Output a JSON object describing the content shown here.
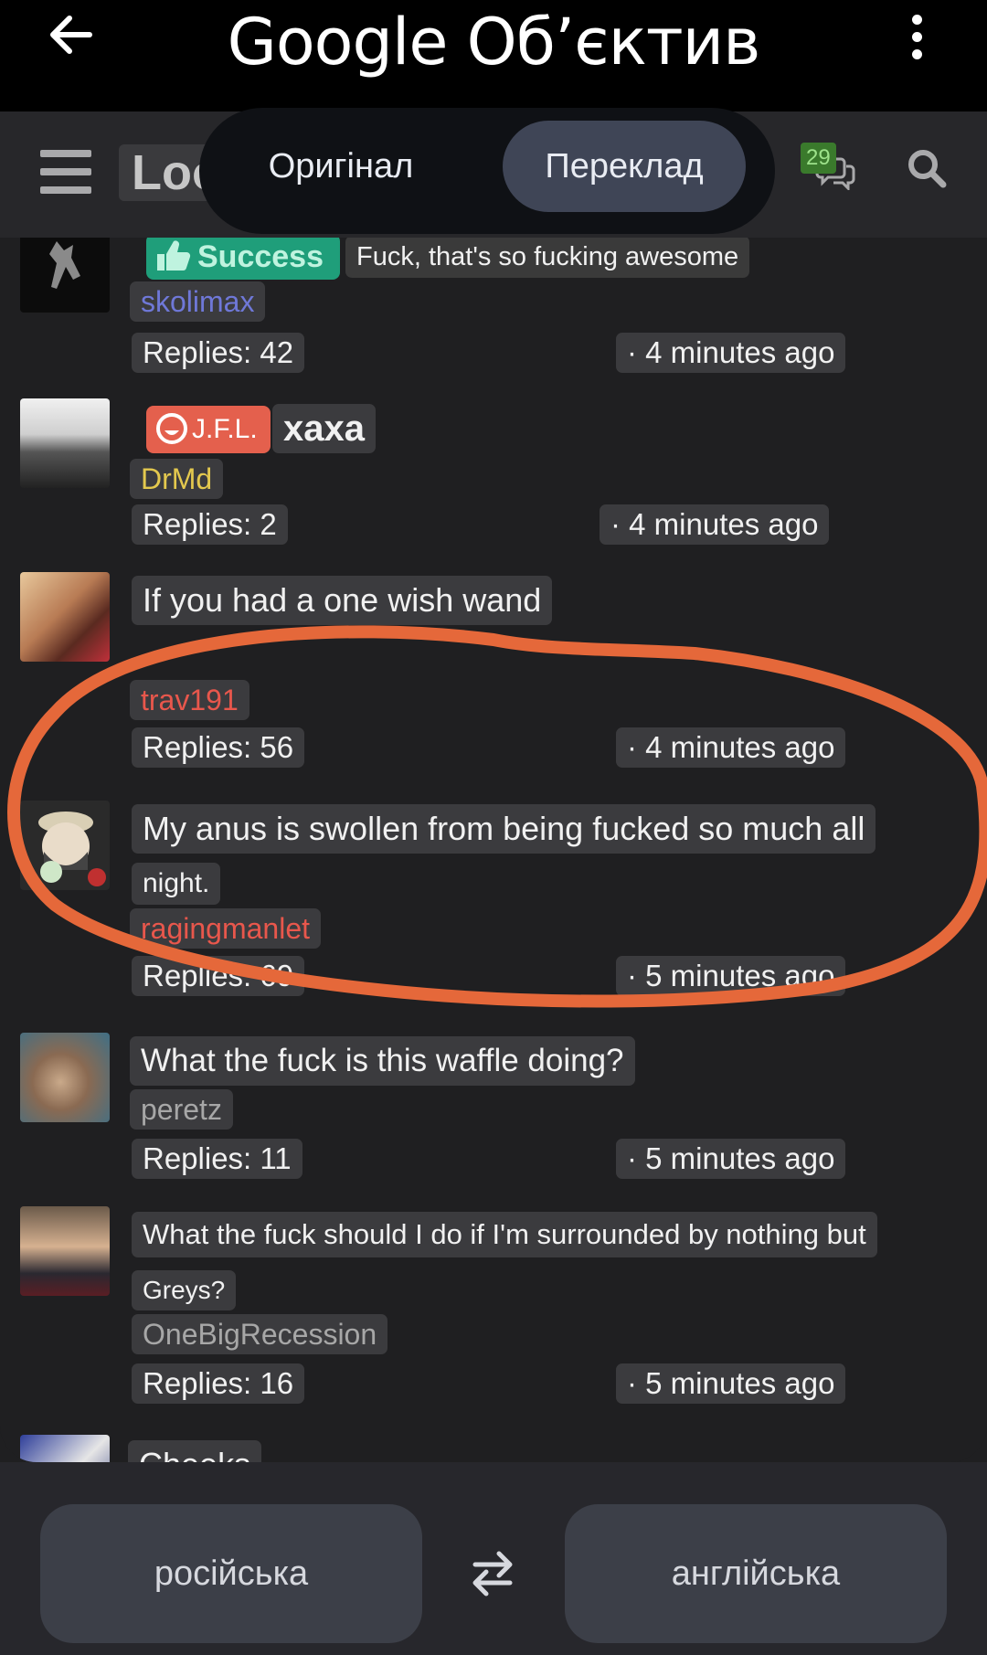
{
  "lens": {
    "title": "Google Об’єктив"
  },
  "app": {
    "logo_text": "Loo",
    "notifications_count": "29"
  },
  "toggle": {
    "original": "Оригінал",
    "translated": "Переклад"
  },
  "posts": [
    {
      "badge": "Success",
      "title": "Fuck, that's so fucking awesome",
      "user": "skolimax",
      "replies": "Replies: 42",
      "time": "· 4 minutes ago"
    },
    {
      "badge": "J.F.L.",
      "title": "xaxa",
      "user": "DrMd",
      "replies": "Replies: 2",
      "time": "· 4 minutes ago"
    },
    {
      "title": "If you had a one wish wand",
      "user": "trav191",
      "replies": "Replies: 56",
      "time": "· 4 minutes ago"
    },
    {
      "title": "My anus is swollen from being fucked so much all",
      "title_cont": "night.",
      "user": "ragingmanlet",
      "replies": "Replies: 69",
      "time": "· 5 minutes ago"
    },
    {
      "title": "What the fuck is this waffle doing?",
      "user": "peretz",
      "replies": "Replies: 11",
      "time": "· 5 minutes ago"
    },
    {
      "title": "What the fuck should I do if I'm surrounded by nothing but",
      "title_cont": "Greys?",
      "user": "OneBigRecession",
      "replies": "Replies: 16",
      "time": "· 5 minutes ago"
    },
    {
      "title": "Cheeks"
    }
  ],
  "languages": {
    "source": "російська",
    "target": "англійська"
  },
  "colors": {
    "annotation": "#e5683a",
    "success_badge": "#1f9e7a",
    "jfl_badge": "#e4604d",
    "user_skolimax": "#6f78d8",
    "user_drmd": "#e3c84e",
    "user_trav191": "#e8574c",
    "user_ragingmanlet": "#e8574c",
    "user_gray": "#a7a7a7"
  }
}
